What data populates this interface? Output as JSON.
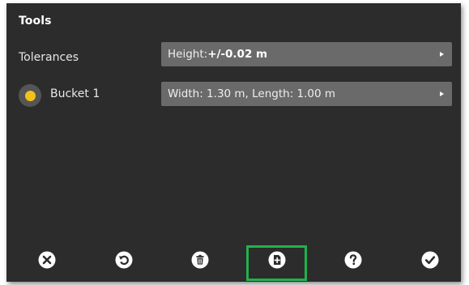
{
  "panel": {
    "title": "Tools"
  },
  "tolerances": {
    "label": "Tolerances",
    "value_prefix": "Height: ",
    "value_bold": "+/-0.02 m"
  },
  "bucket": {
    "label": "Bucket 1",
    "value": "Width: 1.30 m, Length: 1.00 m",
    "dot_color": "#f2c21b"
  },
  "toolbar": {
    "buttons": [
      {
        "name": "cancel",
        "icon": "close-circle-icon"
      },
      {
        "name": "reset",
        "icon": "undo-circle-icon"
      },
      {
        "name": "delete",
        "icon": "trash-circle-icon"
      },
      {
        "name": "add",
        "icon": "add-document-circle-icon",
        "highlighted": true
      },
      {
        "name": "help",
        "icon": "question-circle-icon"
      },
      {
        "name": "accept",
        "icon": "check-circle-icon"
      }
    ]
  },
  "colors": {
    "background": "#2c2c2c",
    "field": "#6a6a6a",
    "highlight": "#22b14c"
  }
}
